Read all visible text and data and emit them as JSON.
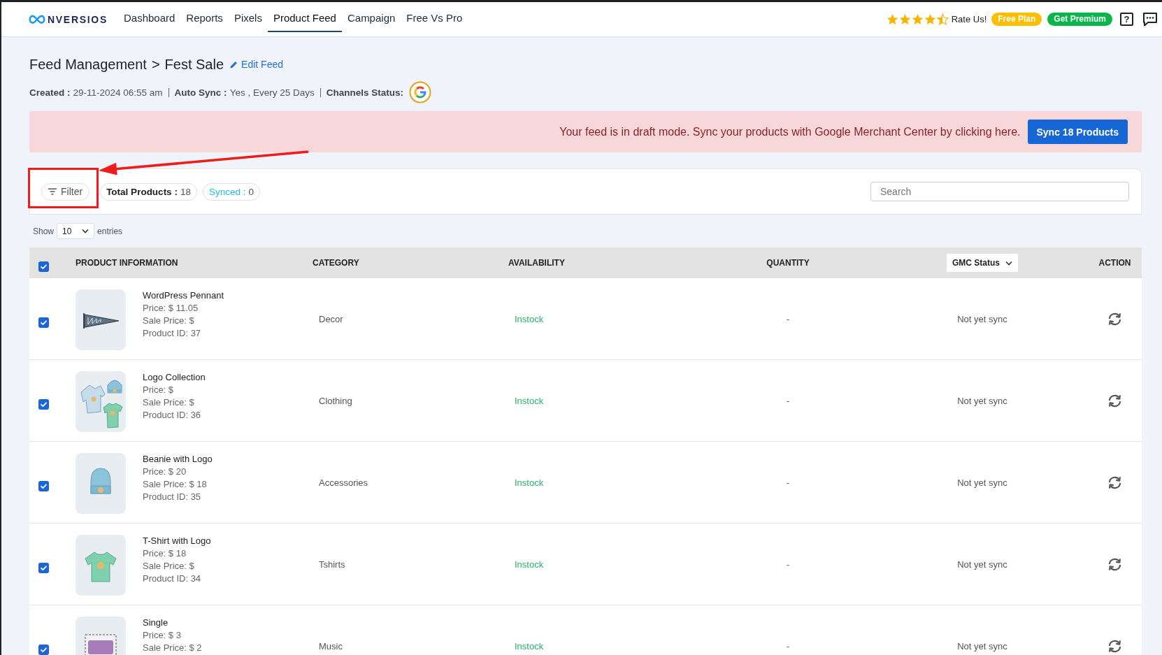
{
  "nav": {
    "logo": "NVERSIOS",
    "items": [
      {
        "label": "Dashboard",
        "selected": false
      },
      {
        "label": "Reports",
        "selected": false
      },
      {
        "label": "Pixels",
        "selected": false
      },
      {
        "label": "Product Feed",
        "selected": true
      },
      {
        "label": "Campaign",
        "selected": false
      },
      {
        "label": "Free Vs Pro",
        "selected": false
      }
    ],
    "rating": {
      "stars": 4.5,
      "label": "Rate Us!"
    },
    "plan_badge": "Free Plan",
    "premium_button": "Get Premium",
    "help_button": "?"
  },
  "feed_header": {
    "parent": "Feed Management",
    "separator": ">",
    "current": "Fest Sale",
    "edit_link": "Edit Feed",
    "meta": [
      {
        "kind": "text",
        "label": "Created :",
        "value": "29-11-2024 06:55 am"
      },
      {
        "kind": "text",
        "label": "Auto Sync :",
        "value": "Yes , Every 25 Days"
      },
      {
        "kind": "icon",
        "label": "Channels Status:"
      }
    ]
  },
  "banner": {
    "message": "Your feed is in draft mode. Sync your products with Google Merchant Center by clicking here.",
    "button": "Sync 18 Products"
  },
  "toolbar": {
    "filter_button": "Filter",
    "counters": [
      {
        "kind": "total",
        "label": "Total Products :",
        "value": "18"
      },
      {
        "kind": "synced",
        "label": "Synced :",
        "value": "0"
      }
    ],
    "search": {
      "placeholder": "Search"
    }
  },
  "entries": {
    "prefix": "Show",
    "value": "10",
    "suffix": "entries"
  },
  "table": {
    "select_all": {
      "checked": true
    },
    "columns": [
      {
        "kind": "text",
        "label": "PRODUCT INFORMATION"
      },
      {
        "kind": "text",
        "label": "CATEGORY"
      },
      {
        "kind": "text",
        "label": "AVAILABILITY"
      },
      {
        "kind": "text",
        "label": "QUANTITY"
      },
      {
        "kind": "dropdown",
        "label": "GMC Status"
      },
      {
        "kind": "text",
        "label": "ACTION"
      }
    ],
    "rows": [
      {
        "kind": "pennant",
        "checked": true,
        "name": "WordPress Pennant",
        "price": "Price: $ 11.05",
        "sale_price": "Sale Price: $",
        "product_id": "Product ID: 37",
        "category": "Decor",
        "availability": "Instock",
        "quantity": "-",
        "gmc_status": "Not yet sync"
      },
      {
        "kind": "clothing",
        "checked": true,
        "name": "Logo Collection",
        "price": "Price: $",
        "sale_price": "Sale Price: $",
        "product_id": "Product ID: 36",
        "category": "Clothing",
        "availability": "Instock",
        "quantity": "-",
        "gmc_status": "Not yet sync"
      },
      {
        "kind": "beanie",
        "checked": true,
        "name": "Beanie with Logo",
        "price": "Price: $ 20",
        "sale_price": "Sale Price: $ 18",
        "product_id": "Product ID: 35",
        "category": "Accessories",
        "availability": "Instock",
        "quantity": "-",
        "gmc_status": "Not yet sync"
      },
      {
        "kind": "tshirt",
        "checked": true,
        "name": "T-Shirt with Logo",
        "price": "Price: $ 18",
        "sale_price": "Sale Price: $",
        "product_id": "Product ID: 34",
        "category": "Tshirts",
        "availability": "Instock",
        "quantity": "-",
        "gmc_status": "Not yet sync"
      },
      {
        "kind": "album",
        "checked": true,
        "name": "Single",
        "price": "Price: $ 3",
        "sale_price": "Sale Price: $ 2",
        "category": "Music",
        "availability": "Instock",
        "quantity": "-",
        "gmc_status": "Not yet sync"
      }
    ]
  }
}
